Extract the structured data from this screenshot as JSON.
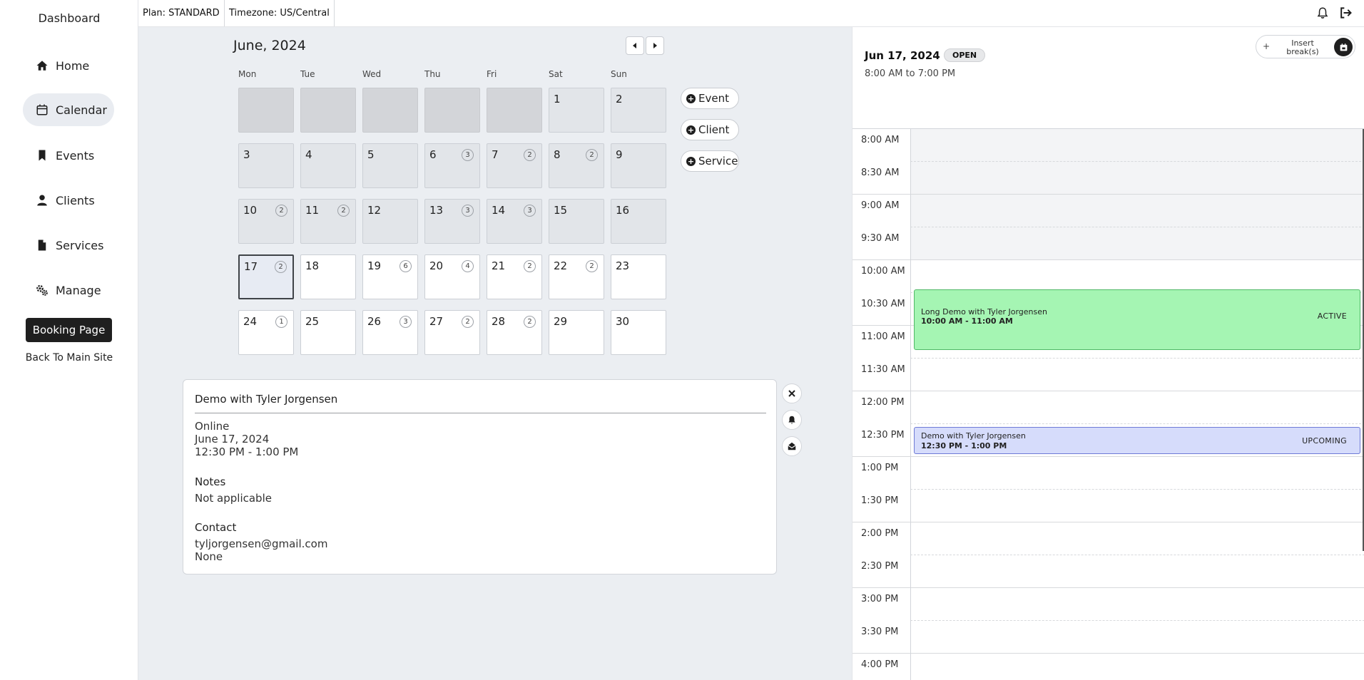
{
  "sidebar": {
    "brand": "Dashboard",
    "items": [
      {
        "label": "Home",
        "icon": "home-icon"
      },
      {
        "label": "Calendar",
        "icon": "calendar-icon"
      },
      {
        "label": "Events",
        "icon": "bookmark-icon"
      },
      {
        "label": "Clients",
        "icon": "user-icon"
      },
      {
        "label": "Services",
        "icon": "document-icon"
      },
      {
        "label": "Manage",
        "icon": "gears-icon"
      }
    ],
    "booking_button": "Booking Page",
    "back_link": "Back To Main Site"
  },
  "topbar": {
    "plan": "Plan: STANDARD",
    "timezone": "Timezone: US/Central",
    "icons": [
      "bell-icon",
      "logout-icon"
    ]
  },
  "calendar": {
    "title": "June, 2024",
    "weekdays": [
      "Mon",
      "Tue",
      "Wed",
      "Thu",
      "Fri",
      "Sat",
      "Sun"
    ],
    "days": [
      {
        "num": "1",
        "badge": ""
      },
      {
        "num": "2",
        "badge": ""
      },
      {
        "num": "3",
        "badge": ""
      },
      {
        "num": "4",
        "badge": ""
      },
      {
        "num": "5",
        "badge": ""
      },
      {
        "num": "6",
        "badge": "3"
      },
      {
        "num": "7",
        "badge": "2"
      },
      {
        "num": "8",
        "badge": "2"
      },
      {
        "num": "9",
        "badge": ""
      },
      {
        "num": "10",
        "badge": "2"
      },
      {
        "num": "11",
        "badge": "2"
      },
      {
        "num": "12",
        "badge": ""
      },
      {
        "num": "13",
        "badge": "3"
      },
      {
        "num": "14",
        "badge": "3"
      },
      {
        "num": "15",
        "badge": ""
      },
      {
        "num": "16",
        "badge": ""
      },
      {
        "num": "17",
        "badge": "2"
      },
      {
        "num": "18",
        "badge": ""
      },
      {
        "num": "19",
        "badge": "6"
      },
      {
        "num": "20",
        "badge": "4"
      },
      {
        "num": "21",
        "badge": "2"
      },
      {
        "num": "22",
        "badge": "2"
      },
      {
        "num": "23",
        "badge": ""
      },
      {
        "num": "24",
        "badge": "1"
      },
      {
        "num": "25",
        "badge": ""
      },
      {
        "num": "26",
        "badge": "3"
      },
      {
        "num": "27",
        "badge": "2"
      },
      {
        "num": "28",
        "badge": "2"
      },
      {
        "num": "29",
        "badge": ""
      },
      {
        "num": "30",
        "badge": ""
      }
    ],
    "selected_day": "17",
    "add_buttons": [
      "Event",
      "Client",
      "Service"
    ]
  },
  "detail": {
    "title": "Demo with Tyler Jorgensen",
    "location": "Online",
    "date": "June 17, 2024",
    "time": "12:30 PM - 1:00 PM",
    "notes_label": "Notes",
    "notes": "Not applicable",
    "contact_label": "Contact",
    "email": "tyljorgensen@gmail.com",
    "phone": "None"
  },
  "day_panel": {
    "date": "Jun 17, 2024",
    "status": "OPEN",
    "hours": "8:00 AM to 7:00 PM",
    "insert_label": "Insert break(s)",
    "insert_plus": "+",
    "times": [
      "8:00 AM",
      "8:30 AM",
      "9:00 AM",
      "9:30 AM",
      "10:00 AM",
      "10:30 AM",
      "11:00 AM",
      "11:30 AM",
      "12:00 PM",
      "12:30 PM",
      "1:00 PM",
      "1:30 PM",
      "2:00 PM",
      "2:30 PM",
      "3:00 PM",
      "3:30 PM",
      "4:00 PM"
    ],
    "events": [
      {
        "title": "Long Demo with Tyler Jorgensen",
        "time": "10:00 AM - 11:00 AM",
        "status": "ACTIVE"
      },
      {
        "title": "Demo with Tyler Jorgensen",
        "time": "12:30 PM - 1:00 PM",
        "status": "UPCOMING"
      }
    ]
  },
  "colors": {
    "active_event": "#a5f5b3",
    "upcoming_event": "#d6dcfb",
    "accent_dark": "#1f1f1f"
  }
}
